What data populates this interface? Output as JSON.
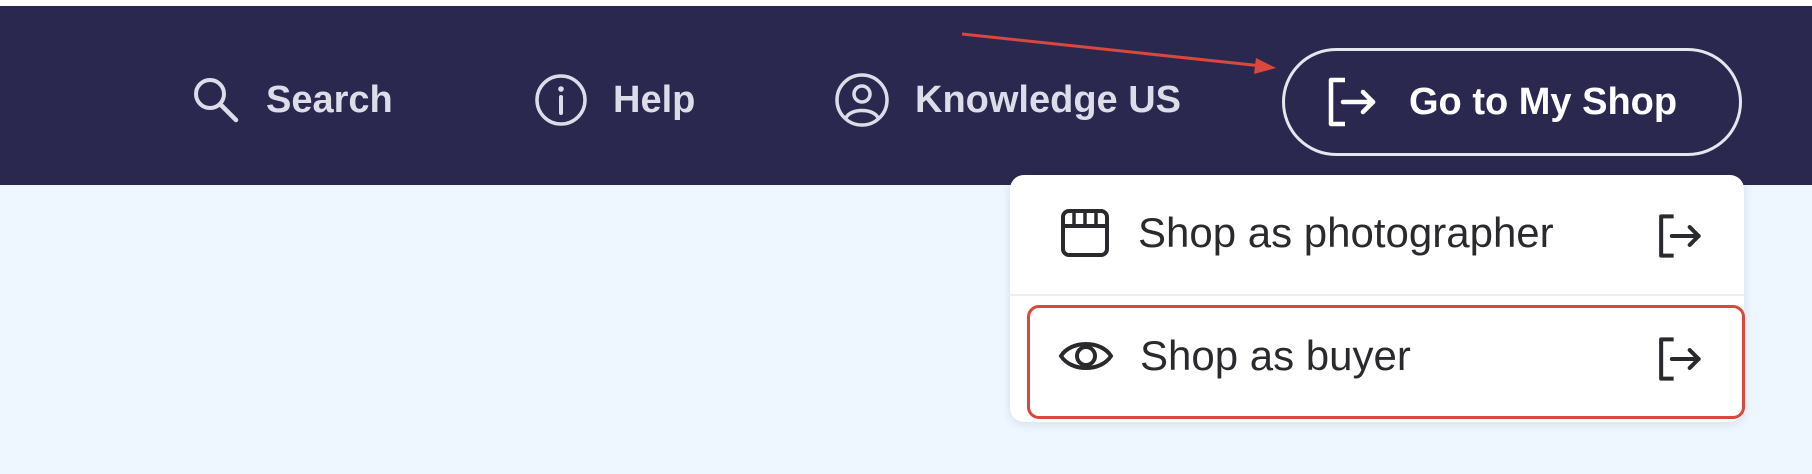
{
  "nav": {
    "search_label": "Search",
    "help_label": "Help",
    "knowledge_label": "Knowledge US"
  },
  "shop_button": {
    "label": "Go to My Shop"
  },
  "dropdown": {
    "items": [
      {
        "label": "Shop as photographer",
        "icon": "storefront-icon",
        "trailing_icon": "exit-arrow-icon"
      },
      {
        "label": "Shop as buyer",
        "icon": "eye-icon",
        "trailing_icon": "exit-arrow-icon"
      }
    ]
  },
  "colors": {
    "topbar_background": "#2b2850",
    "content_background": "#eef7ff",
    "annotation_red": "#d9473d"
  }
}
